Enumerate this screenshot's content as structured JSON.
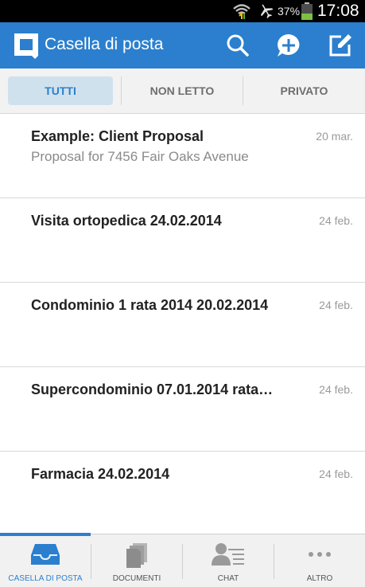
{
  "status_bar": {
    "battery_percent": "37%",
    "time": "17:08",
    "icons": [
      "wifi-icon",
      "airplane-icon",
      "battery-icon"
    ]
  },
  "app_bar": {
    "title": "Casella di posta",
    "color": "#2b7fce",
    "icons": [
      "app-logo-icon",
      "search-icon",
      "add-chat-icon",
      "compose-icon"
    ]
  },
  "tabs": [
    {
      "label": "TUTTI",
      "active": true
    },
    {
      "label": "NON LETTO",
      "active": false
    },
    {
      "label": "PRIVATO",
      "active": false
    }
  ],
  "messages": [
    {
      "subject": "Example: Client Proposal",
      "preview": "Proposal for 7456 Fair Oaks Avenue",
      "date": "20 mar."
    },
    {
      "subject": "Visita ortopedica 24.02.2014",
      "preview": "",
      "date": "24 feb."
    },
    {
      "subject": "Condominio 1 rata 2014 20.02.2014",
      "preview": "",
      "date": "24 feb."
    },
    {
      "subject": "Supercondominio 07.01.2014 rata…",
      "preview": "",
      "date": "24 feb."
    },
    {
      "subject": "Farmacia 24.02.2014",
      "preview": "",
      "date": "24 feb."
    }
  ],
  "bottom_nav": [
    {
      "label": "CASELLA DI POSTA",
      "icon": "inbox-tray-icon",
      "active": true
    },
    {
      "label": "DOCUMENTI",
      "icon": "documents-icon",
      "active": false
    },
    {
      "label": "CHAT",
      "icon": "chat-contact-icon",
      "active": false
    },
    {
      "label": "ALTRO",
      "icon": "more-dots-icon",
      "active": false
    }
  ]
}
